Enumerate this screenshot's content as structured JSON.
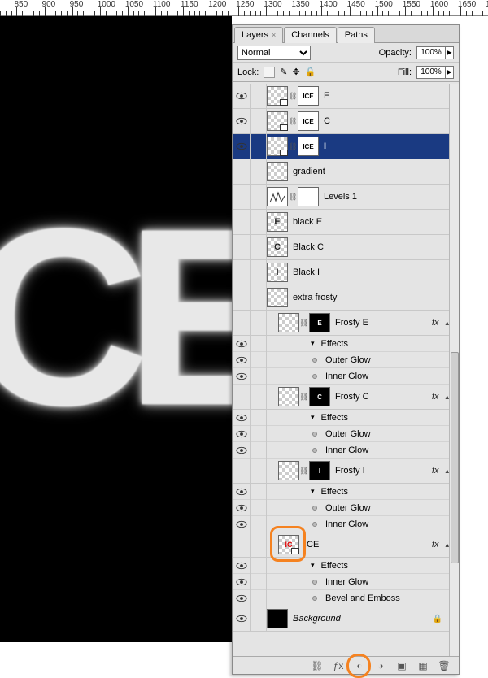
{
  "ruler": {
    "start": 820,
    "end": 1700,
    "step": 50,
    "pxStart": -20
  },
  "panel": {
    "tabs": [
      {
        "label": "Layers",
        "active": true,
        "closeable": true
      },
      {
        "label": "Channels",
        "active": false
      },
      {
        "label": "Paths",
        "active": false
      }
    ],
    "blend_mode": "Normal",
    "opacity_label": "Opacity:",
    "opacity_value": "100%",
    "lock_label": "Lock:",
    "fill_label": "Fill:",
    "fill_value": "100%"
  },
  "layers": [
    {
      "kind": "layer",
      "visible": true,
      "indent": 0,
      "thumb": "trans-smart",
      "mask": "ICE",
      "name": "E"
    },
    {
      "kind": "layer",
      "visible": true,
      "indent": 0,
      "thumb": "trans-smart",
      "mask": "ICE",
      "name": "C"
    },
    {
      "kind": "layer",
      "visible": true,
      "indent": 0,
      "thumb": "trans-smart",
      "mask": "ICE",
      "name": "I",
      "selected": true
    },
    {
      "kind": "layer",
      "visible": false,
      "indent": 0,
      "thumb": "trans",
      "name": "gradient"
    },
    {
      "kind": "layer",
      "visible": false,
      "indent": 0,
      "thumb": "levels",
      "mask": "white",
      "name": "Levels 1"
    },
    {
      "kind": "layer",
      "visible": false,
      "indent": 0,
      "thumb": "trans",
      "text": "E",
      "name": "black E"
    },
    {
      "kind": "layer",
      "visible": false,
      "indent": 0,
      "thumb": "trans",
      "text": "C",
      "name": "Black C"
    },
    {
      "kind": "layer",
      "visible": false,
      "indent": 0,
      "thumb": "trans",
      "text": "I",
      "name": "Black I"
    },
    {
      "kind": "layer",
      "visible": false,
      "indent": 0,
      "thumb": "trans",
      "name": "extra frosty"
    },
    {
      "kind": "layer",
      "visible": false,
      "indent": 1,
      "thumb": "trans",
      "mask": "blackE",
      "name": "Frosty E",
      "fx": true
    },
    {
      "kind": "fxhead",
      "visible": true,
      "indent": 2,
      "name": "Effects"
    },
    {
      "kind": "fx",
      "visible": true,
      "indent": 2,
      "name": "Outer Glow"
    },
    {
      "kind": "fx",
      "visible": true,
      "indent": 2,
      "name": "Inner Glow"
    },
    {
      "kind": "layer",
      "visible": false,
      "indent": 1,
      "thumb": "trans",
      "mask": "blackC",
      "name": "Frosty C",
      "fx": true
    },
    {
      "kind": "fxhead",
      "visible": true,
      "indent": 2,
      "name": "Effects"
    },
    {
      "kind": "fx",
      "visible": true,
      "indent": 2,
      "name": "Outer Glow"
    },
    {
      "kind": "fx",
      "visible": true,
      "indent": 2,
      "name": "Inner Glow"
    },
    {
      "kind": "layer",
      "visible": false,
      "indent": 1,
      "thumb": "trans",
      "mask": "blackI",
      "name": "Frosty I",
      "fx": true
    },
    {
      "kind": "fxhead",
      "visible": true,
      "indent": 2,
      "name": "Effects"
    },
    {
      "kind": "fx",
      "visible": true,
      "indent": 2,
      "name": "Outer Glow"
    },
    {
      "kind": "fx",
      "visible": true,
      "indent": 2,
      "name": "Inner Glow"
    },
    {
      "kind": "layer",
      "visible": false,
      "indent": 1,
      "thumb": "ice-smart",
      "name": "ICE",
      "fx": true,
      "highlight": true
    },
    {
      "kind": "fxhead",
      "visible": true,
      "indent": 2,
      "name": "Effects"
    },
    {
      "kind": "fx",
      "visible": true,
      "indent": 2,
      "name": "Inner Glow"
    },
    {
      "kind": "fx",
      "visible": true,
      "indent": 2,
      "name": "Bevel and Emboss"
    },
    {
      "kind": "layer",
      "visible": true,
      "indent": 0,
      "thumb": "black",
      "name": "Background",
      "bg": true
    }
  ],
  "bottom_icons": [
    "link",
    "fx",
    "mask",
    "adjust",
    "folder",
    "new",
    "trash"
  ],
  "highlight_bottom_index": 2
}
